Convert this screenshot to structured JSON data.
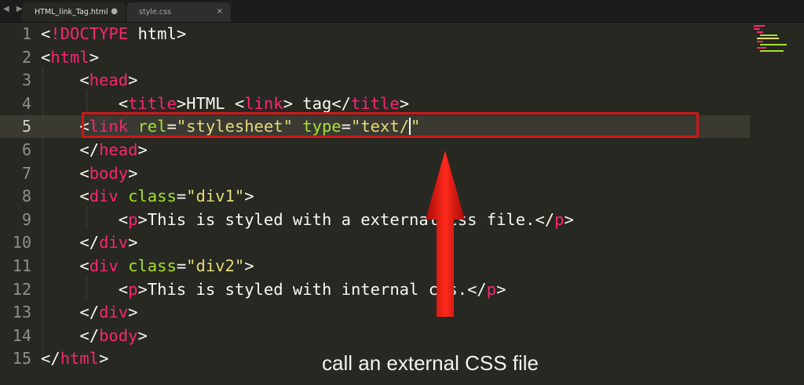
{
  "tabs": [
    {
      "label": "HTML_link_Tag.html",
      "control": "●",
      "active": true
    },
    {
      "label": "style.css",
      "control": "×",
      "active": false
    }
  ],
  "nav_arrows": "◀ ▶",
  "editor": {
    "current_line": 5,
    "lines": [
      {
        "num": "1",
        "text": "<!DOCTYPE html>"
      },
      {
        "num": "2",
        "text": "<html>"
      },
      {
        "num": "3",
        "text": "    <head>"
      },
      {
        "num": "4",
        "text": "        <title>HTML <link> tag</title>"
      },
      {
        "num": "5",
        "text": "    <link rel=\"stylesheet\" type=\"text/\""
      },
      {
        "num": "6",
        "text": "    </head>"
      },
      {
        "num": "7",
        "text": "    <body>"
      },
      {
        "num": "8",
        "text": "    <div class=\"div1\">"
      },
      {
        "num": "9",
        "text": "        <p>This is styled with a external css file.</p>"
      },
      {
        "num": "10",
        "text": "    </div>"
      },
      {
        "num": "11",
        "text": "    <div class=\"div2\">"
      },
      {
        "num": "12",
        "text": "        <p>This is styled with internal css.</p>"
      },
      {
        "num": "13",
        "text": "    </div>"
      },
      {
        "num": "14",
        "text": "    </body>"
      },
      {
        "num": "15",
        "text": "</html>"
      }
    ]
  },
  "annotation": {
    "caption": "call an external CSS file",
    "box_color": "#d01818",
    "arrow_color": "#e01010"
  },
  "theme": {
    "background": "#272822",
    "tag": "#f92672",
    "attribute": "#a6e22e",
    "string": "#e6db74",
    "text": "#f8f8f2",
    "gutter": "#8f908a"
  }
}
